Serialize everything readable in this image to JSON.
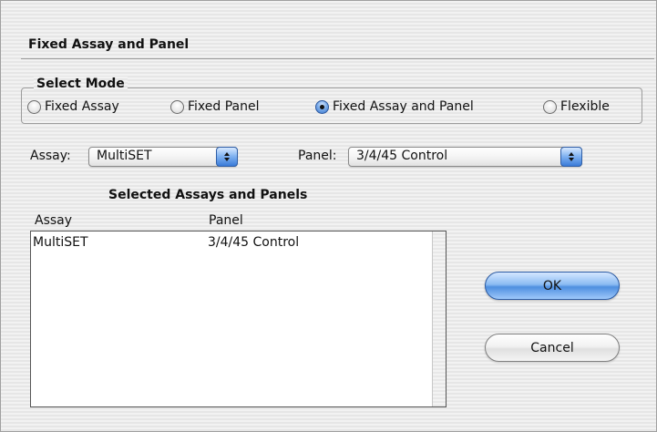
{
  "dialog": {
    "title": "Fixed Assay and Panel"
  },
  "select_mode": {
    "legend": "Select Mode",
    "options": [
      {
        "label": "Fixed Assay",
        "checked": false
      },
      {
        "label": "Fixed Panel",
        "checked": false
      },
      {
        "label": "Fixed Assay and Panel",
        "checked": true
      },
      {
        "label": "Flexible",
        "checked": false
      }
    ]
  },
  "assay": {
    "label": "Assay:",
    "selected": "MultiSET"
  },
  "panel": {
    "label": "Panel:",
    "selected": "3/4/45 Control"
  },
  "selected_list": {
    "heading": "Selected Assays and Panels",
    "columns": [
      "Assay",
      "Panel"
    ],
    "rows": [
      [
        "MultiSET",
        "3/4/45 Control"
      ]
    ]
  },
  "buttons": {
    "ok": "OK",
    "cancel": "Cancel"
  },
  "colors": {
    "accent": "#4f8fe0",
    "window_bg": "#ececec"
  }
}
